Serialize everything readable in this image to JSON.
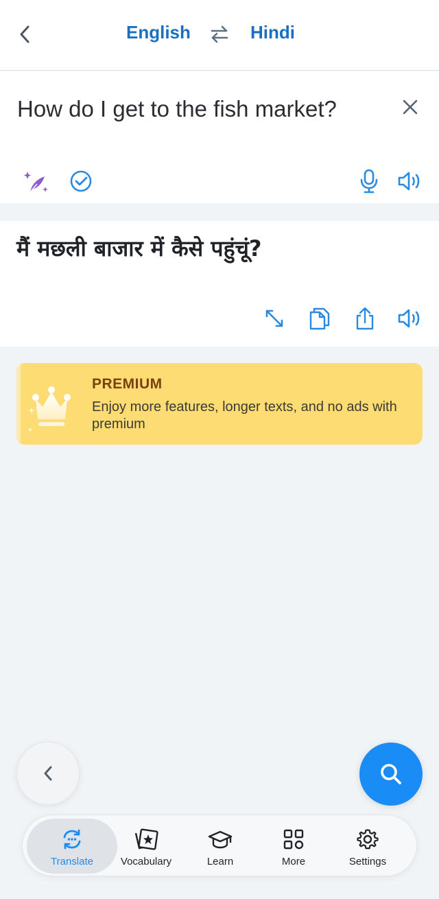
{
  "header": {
    "source_language": "English",
    "target_language": "Hindi"
  },
  "input": {
    "text": "How do I get to the fish market?"
  },
  "output": {
    "text": "मैं मछली बाजार में कैसे पहुंचूं?"
  },
  "premium": {
    "title": "PREMIUM",
    "description": "Enjoy more features, longer texts, and no ads with premium"
  },
  "tabs": [
    {
      "label": "Translate",
      "icon": "translate-icon",
      "active": true
    },
    {
      "label": "Vocabulary",
      "icon": "vocabulary-cards-icon",
      "active": false
    },
    {
      "label": "Learn",
      "icon": "graduation-cap-icon",
      "active": false
    },
    {
      "label": "More",
      "icon": "grid-icon",
      "active": false
    },
    {
      "label": "Settings",
      "icon": "gear-icon",
      "active": false
    }
  ],
  "colors": {
    "accent": "#1b6fc2",
    "fab": "#1a8cf5",
    "premium_bg": "#fddc73",
    "premium_title": "#7a4212",
    "ai_purple": "#8e5bd1"
  }
}
